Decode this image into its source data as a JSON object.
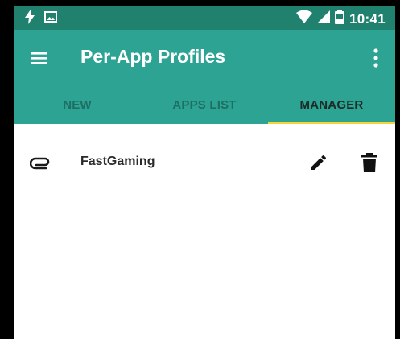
{
  "status_bar": {
    "time": "10:41",
    "left_icons": [
      "lightning-icon",
      "image-icon"
    ],
    "right_icons": [
      "wifi-icon",
      "signal-icon",
      "battery-icon"
    ]
  },
  "app_bar": {
    "title": "Per-App Profiles",
    "menu_icon": "hamburger-menu-icon",
    "overflow_icon": "more-vert-icon"
  },
  "tabs": [
    {
      "label": "NEW",
      "active": false
    },
    {
      "label": "APPS LIST",
      "active": false
    },
    {
      "label": "MANAGER",
      "active": true
    }
  ],
  "profiles": [
    {
      "name": "FastGaming",
      "icon": "paperclip-icon",
      "actions": [
        "edit-icon",
        "delete-icon"
      ]
    }
  ],
  "colors": {
    "status_bar": "#21816F",
    "primary": "#2DA393",
    "tab_indicator": "#F2D43D",
    "background": "#FFFFFF"
  }
}
